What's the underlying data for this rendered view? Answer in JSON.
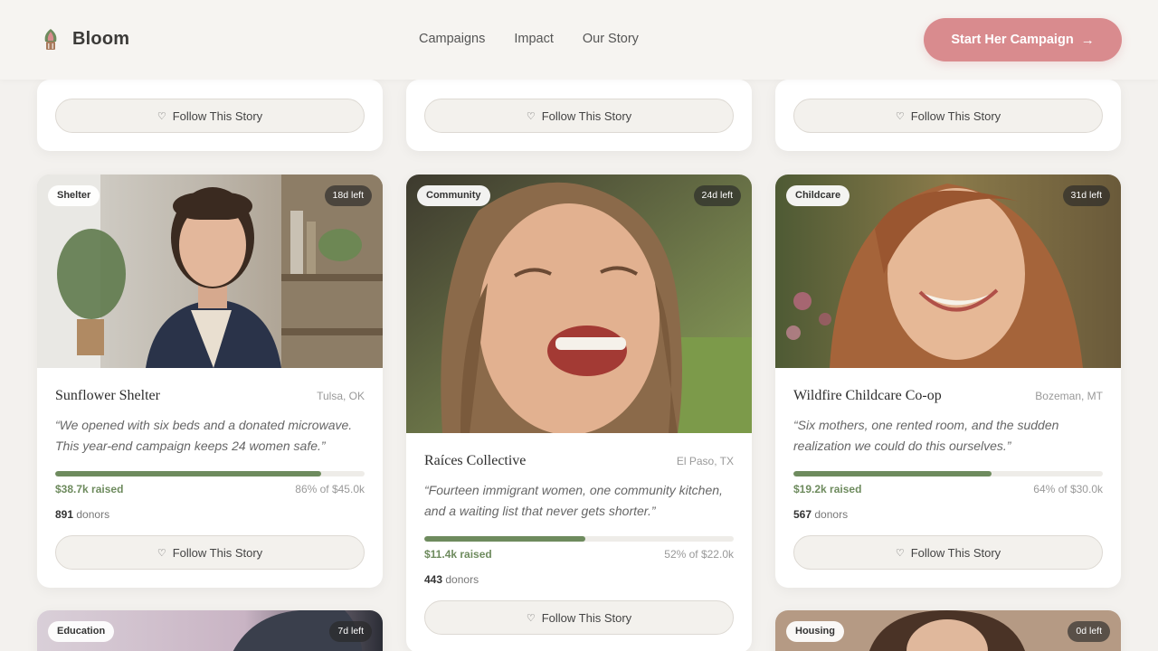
{
  "brand": {
    "name": "Bloom"
  },
  "nav": [
    "Campaigns",
    "Impact",
    "Our Story"
  ],
  "cta": {
    "label": "Start Her Campaign",
    "arrow": "→"
  },
  "follow_label": "Follow This Story",
  "cards": [
    {
      "tag": "Shelter",
      "days_left": "18d left",
      "title": "Sunflower Shelter",
      "location": "Tulsa, OK",
      "quote": "“We opened with six beds and a donated microwave. This year-end campaign keeps 24 women safe.”",
      "raised": "$38.7k raised",
      "progress": 0.86,
      "pct_text": "86% of $45.0k",
      "donors_count": "891",
      "donors_label": "donors"
    },
    {
      "tag": "Community",
      "days_left": "24d left",
      "title": "Raíces Collective",
      "location": "El Paso, TX",
      "quote": "“Fourteen immigrant women, one community kitchen, and a waiting list that never gets shorter.”",
      "raised": "$11.4k raised",
      "progress": 0.52,
      "pct_text": "52% of $22.0k",
      "donors_count": "443",
      "donors_label": "donors"
    },
    {
      "tag": "Childcare",
      "days_left": "31d left",
      "title": "Wildfire Childcare Co-op",
      "location": "Bozeman, MT",
      "quote": "“Six mothers, one rented room, and the sudden realization we could do this ourselves.”",
      "raised": "$19.2k raised",
      "progress": 0.64,
      "pct_text": "64% of $30.0k",
      "donors_count": "567",
      "donors_label": "donors"
    }
  ],
  "bottom_cards": [
    {
      "tag": "Education",
      "days_left": "7d left"
    },
    {
      "tag": "Housing",
      "days_left": "0d left"
    }
  ],
  "colors": {
    "accent": "#d98b8e",
    "progress": "#6e8b5e",
    "background": "#f3f1ee"
  }
}
